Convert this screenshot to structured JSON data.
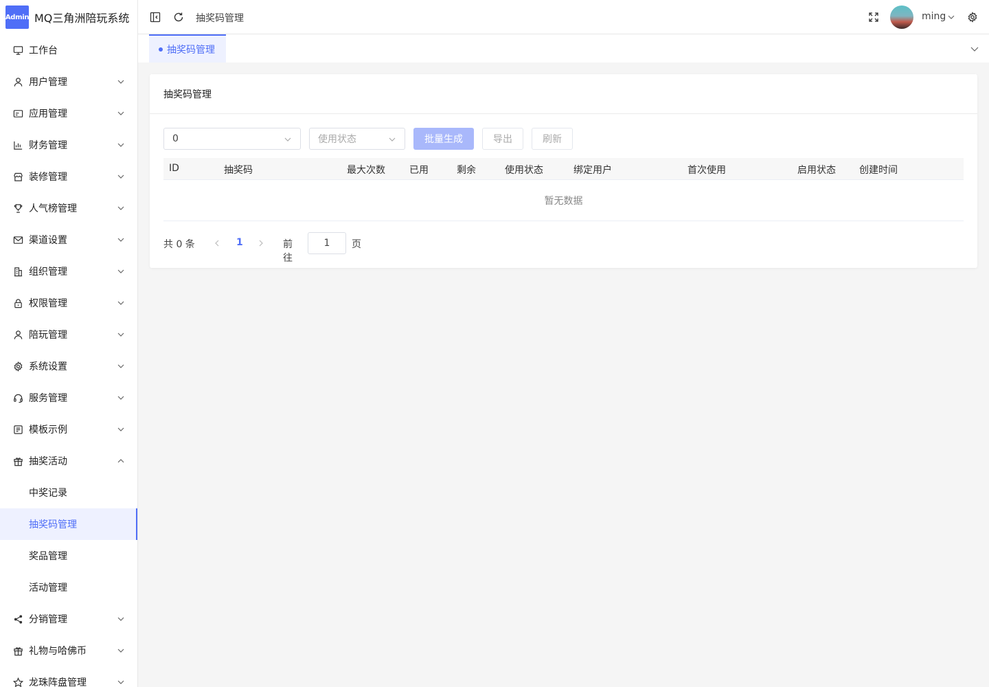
{
  "app": {
    "logo_badge": "Admin",
    "title": "MQ三角洲陪玩系统"
  },
  "sidebar": {
    "items": [
      {
        "label": "工作台",
        "icon": "monitor-icon"
      },
      {
        "label": "用户管理",
        "icon": "user-icon"
      },
      {
        "label": "应用管理",
        "icon": "app-card-icon"
      },
      {
        "label": "财务管理",
        "icon": "bar-chart-icon"
      },
      {
        "label": "装修管理",
        "icon": "shop-icon"
      },
      {
        "label": "人气榜管理",
        "icon": "trophy-icon"
      },
      {
        "label": "渠道设置",
        "icon": "mail-icon"
      },
      {
        "label": "组织管理",
        "icon": "building-icon"
      },
      {
        "label": "权限管理",
        "icon": "lock-icon"
      },
      {
        "label": "陪玩管理",
        "icon": "user-icon"
      },
      {
        "label": "系统设置",
        "icon": "gear-icon"
      },
      {
        "label": "服务管理",
        "icon": "headset-icon"
      },
      {
        "label": "模板示例",
        "icon": "template-icon"
      },
      {
        "label": "抽奖活动",
        "icon": "gift-icon"
      },
      {
        "label": "分销管理",
        "icon": "share-icon"
      },
      {
        "label": "礼物与哈佛币",
        "icon": "gift-icon"
      },
      {
        "label": "龙珠阵盘管理",
        "icon": "star-icon"
      }
    ],
    "sub_items": [
      {
        "label": "中奖记录"
      },
      {
        "label": "抽奖码管理"
      },
      {
        "label": "奖品管理"
      },
      {
        "label": "活动管理"
      }
    ]
  },
  "header": {
    "breadcrumb": "抽奖码管理",
    "username": "ming"
  },
  "tabs": [
    {
      "label": "抽奖码管理"
    }
  ],
  "card": {
    "title": "抽奖码管理",
    "filter_select_value": "0",
    "status_select_placeholder": "使用状态",
    "buttons": {
      "batch_generate": "批量生成",
      "export": "导出",
      "refresh": "刷新"
    },
    "table": {
      "columns": [
        "ID",
        "抽奖码",
        "最大次数",
        "已用",
        "剩余",
        "使用状态",
        "绑定用户",
        "首次使用",
        "启用状态",
        "创建时间"
      ],
      "rows": [],
      "empty_text": "暂无数据"
    },
    "pagination": {
      "total_text": "共 0 条",
      "current_page": "1",
      "goto_label": "前往",
      "goto_value": "1",
      "page_suffix": "页"
    }
  },
  "colors": {
    "accent": "#4f6ef7",
    "primary_disabled": "#a9b8fb",
    "active_bg": "#eef1ff"
  }
}
